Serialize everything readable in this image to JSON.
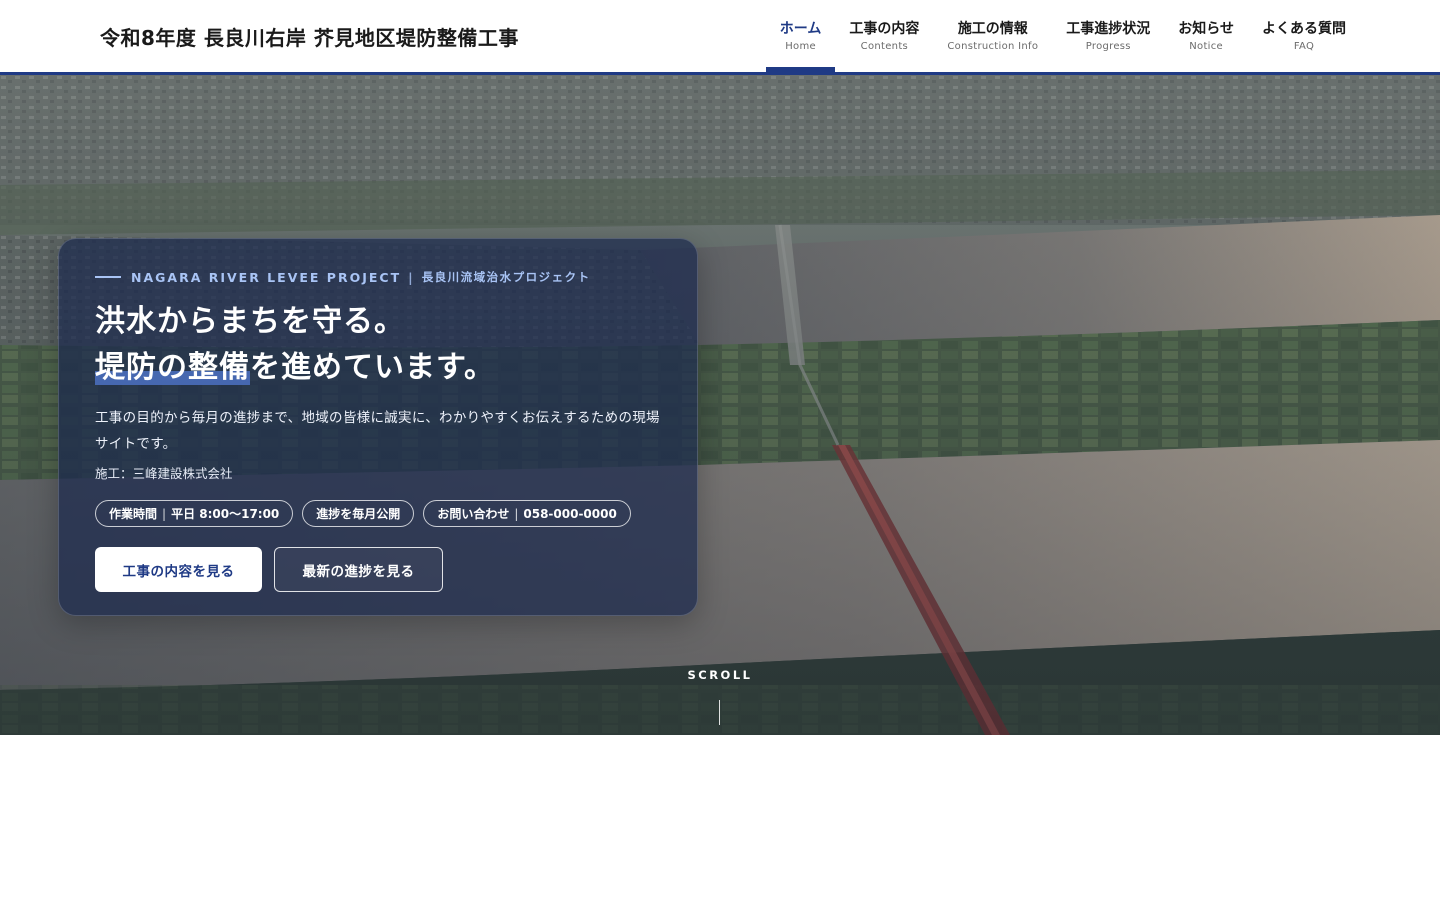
{
  "header": {
    "site_title": "令和8年度 長良川右岸 芥見地区堤防整備工事",
    "nav": [
      {
        "jp": "ホーム",
        "en": "Home",
        "active": true
      },
      {
        "jp": "工事の内容",
        "en": "Contents"
      },
      {
        "jp": "施工の情報",
        "en": "Construction Info"
      },
      {
        "jp": "工事進捗状況",
        "en": "Progress"
      },
      {
        "jp": "お知らせ",
        "en": "Notice"
      },
      {
        "jp": "よくある質問",
        "en": "FAQ"
      }
    ]
  },
  "hero": {
    "eyebrow_en": "NAGARA RIVER LEVEE PROJECT",
    "eyebrow_sep": "|",
    "eyebrow_jp": "長良川流域治水プロジェクト",
    "headline_line1": "洪水からまちを守る。",
    "headline_line2_highlight": "堤防の整備",
    "headline_line2_rest": "を進めています。",
    "description": "工事の目的から毎月の進捗まで、地域の皆様に誠実に、わかりやすくお伝えするための現場サイトです。",
    "builder": "施工：三峰建設株式会社",
    "pills": {
      "hours_label": "作業時間",
      "hours_value": "平日 8:00〜17:00",
      "monthly": "進捗を毎月公開",
      "contact_label": "お問い合わせ",
      "contact_value": "058-000-0000",
      "sep": "|"
    },
    "buttons": {
      "primary": "工事の内容を見る",
      "secondary": "最新の進捗を見る"
    },
    "scroll_label": "SCROLL"
  },
  "colors": {
    "brand": "#1f3a85",
    "card_bg": "rgba(28,42,78,0.72)",
    "eyebrow": "#a9c4f5"
  }
}
